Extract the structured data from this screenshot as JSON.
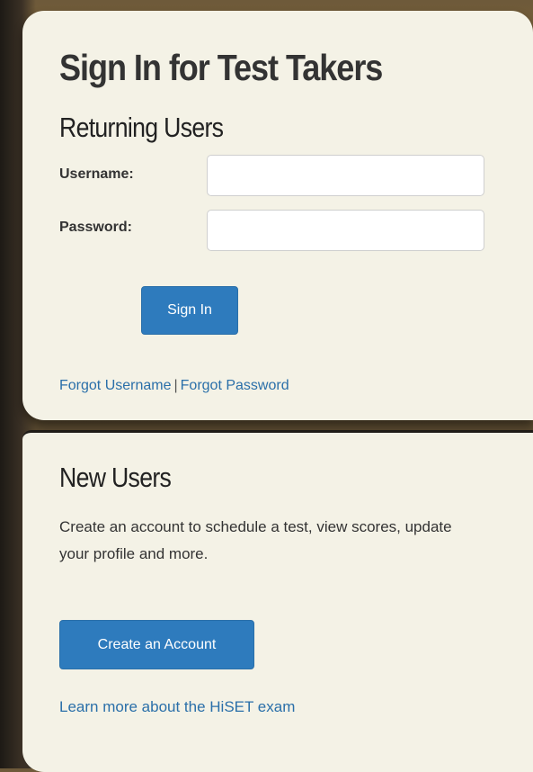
{
  "signin_panel": {
    "title": "Sign In for Test Takers",
    "returning_heading": "Returning Users",
    "username_label": "Username:",
    "username_value": "",
    "password_label": "Password:",
    "password_value": "",
    "signin_button": "Sign In",
    "forgot_username": "Forgot Username",
    "separator": "|",
    "forgot_password": "Forgot Password"
  },
  "new_users_panel": {
    "heading": "New Users",
    "description": "Create an account to schedule a test, view scores, update your profile and more.",
    "create_button": "Create an Account",
    "learn_more": "Learn more about the HiSET exam"
  },
  "colors": {
    "panel_bg": "#f4f2e6",
    "accent_blue": "#2e7bbd",
    "link_blue": "#2a6fa9",
    "text_dark": "#333333"
  }
}
